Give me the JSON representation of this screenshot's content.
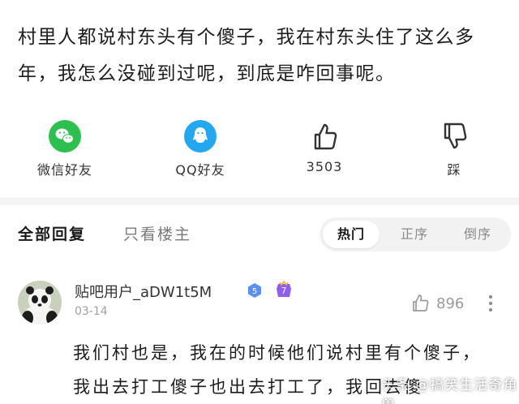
{
  "post": {
    "text": "村里人都说村东头有个傻子，我在村东头住了这么多年，我怎么没碰到过呢，到底是咋回事呢。"
  },
  "share_bar": {
    "wechat_label": "微信好友",
    "qq_label": "QQ好友",
    "like_count": "3503",
    "dislike_label": "踩"
  },
  "reply_tabs": {
    "all_label": "全部回复",
    "author_only_label": "只看楼主",
    "sort_options": [
      "热门",
      "正序",
      "倒序"
    ],
    "active_sort": "热门"
  },
  "comment": {
    "username": "贴吧用户_aDW1t5M",
    "level": "5",
    "member_level": "7",
    "date": "03-14",
    "like_count": "896",
    "body": "我们村也是，我在的时候他们说村里有个傻子，我出去打工傻子也出去打工了，我回去傻"
  },
  "watermark": "头条 @搞笑生活奇角兽",
  "colors": {
    "wechat_green": "#2dc04e",
    "qq_blue": "#22a7f0",
    "level_badge_blue": "#5b8ff9",
    "member_badge_purple": "#8e5cf0"
  },
  "icons": [
    "wechat-icon",
    "qq-icon",
    "thumbs-up-icon",
    "thumbs-down-icon",
    "more-vertical-icon"
  ]
}
